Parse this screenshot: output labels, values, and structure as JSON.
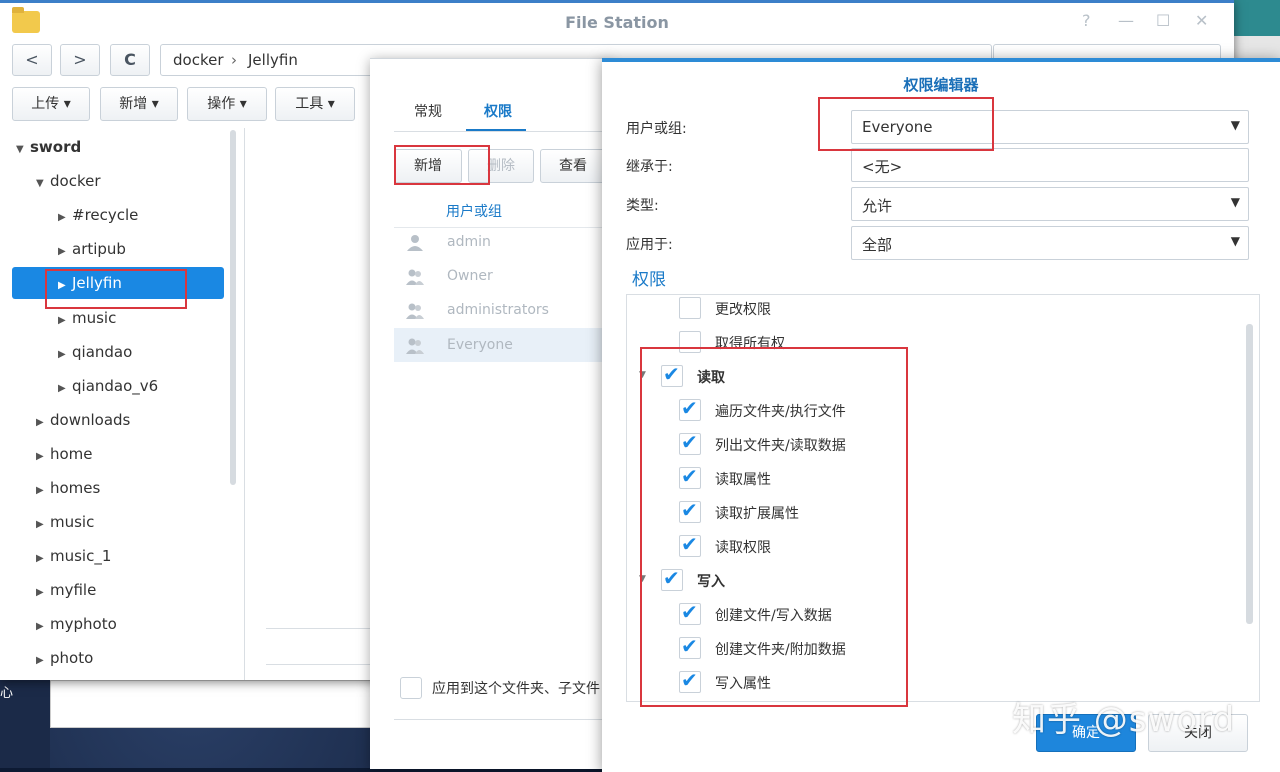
{
  "file_station": {
    "title": "File Station",
    "controls": [
      "?",
      "—",
      "☐",
      "✕"
    ],
    "back": "<",
    "forward": ">",
    "refresh": "C",
    "path": [
      "docker",
      "Jellyfin"
    ],
    "path_sep": "›",
    "toolbar": [
      "上传 ▾",
      "新增 ▾",
      "操作 ▾",
      "工具 ▾"
    ],
    "tree": {
      "root": "sword",
      "items": [
        {
          "label": "docker",
          "level": 1,
          "expanded": true
        },
        {
          "label": "#recycle",
          "level": 2
        },
        {
          "label": "artipub",
          "level": 2
        },
        {
          "label": "Jellyfin",
          "level": 2,
          "selected": true
        },
        {
          "label": "music",
          "level": 2
        },
        {
          "label": "qiandao",
          "level": 2
        },
        {
          "label": "qiandao_v6",
          "level": 2
        },
        {
          "label": "downloads",
          "level": 1
        },
        {
          "label": "home",
          "level": 1
        },
        {
          "label": "homes",
          "level": 1
        },
        {
          "label": "music",
          "level": 1
        },
        {
          "label": "music_1",
          "level": 1
        },
        {
          "label": "myfile",
          "level": 1
        },
        {
          "label": "myphoto",
          "level": 1
        },
        {
          "label": "photo",
          "level": 1
        }
      ]
    }
  },
  "desktop": {
    "left_text": "心"
  },
  "properties": {
    "tabs": [
      "常规",
      "权限"
    ],
    "active_tab": "权限",
    "buttons": {
      "add": "新增",
      "delete": "删除",
      "view": "查看"
    },
    "column_header": "用户或组",
    "users": [
      "admin",
      "Owner",
      "administrators",
      "Everyone"
    ],
    "selected_user": "Everyone",
    "apply_text": "应用到这个文件夹、子文件"
  },
  "perm_editor": {
    "title": "权限编辑器",
    "fields": {
      "user_label": "用户或组:",
      "user_value": "Everyone",
      "inherit_label": "继承于:",
      "inherit_value": "<无>",
      "type_label": "类型:",
      "type_value": "允许",
      "apply_label": "应用于:",
      "apply_value": "全部"
    },
    "section_title": "权限",
    "permissions": [
      {
        "label": "更改权限",
        "checked": false,
        "group": false
      },
      {
        "label": "取得所有权",
        "checked": false,
        "group": false
      },
      {
        "label": "读取",
        "checked": true,
        "group": true
      },
      {
        "label": "遍历文件夹/执行文件",
        "checked": true,
        "group": false
      },
      {
        "label": "列出文件夹/读取数据",
        "checked": true,
        "group": false
      },
      {
        "label": "读取属性",
        "checked": true,
        "group": false
      },
      {
        "label": "读取扩展属性",
        "checked": true,
        "group": false
      },
      {
        "label": "读取权限",
        "checked": true,
        "group": false
      },
      {
        "label": "写入",
        "checked": true,
        "group": true
      },
      {
        "label": "创建文件/写入数据",
        "checked": true,
        "group": false
      },
      {
        "label": "创建文件夹/附加数据",
        "checked": true,
        "group": false
      },
      {
        "label": "写入属性",
        "checked": true,
        "group": false
      }
    ],
    "ok_label": "确定",
    "close_label": "关闭"
  },
  "watermark": "知乎 @sword",
  "colors": {
    "accent": "#1a88e3",
    "annotation": "#d9363e"
  }
}
